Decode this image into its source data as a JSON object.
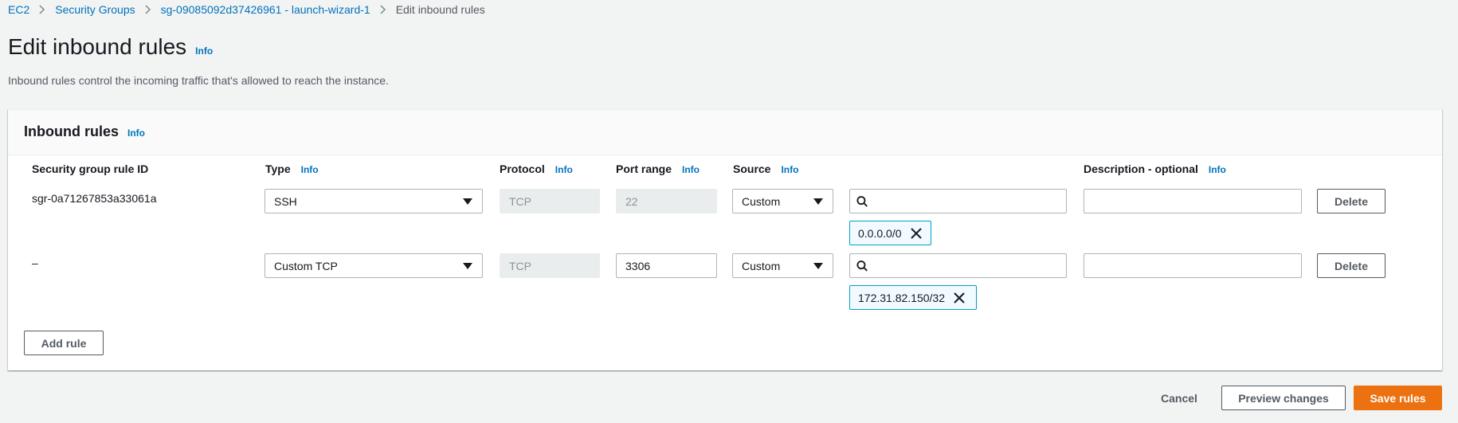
{
  "breadcrumb": {
    "items": [
      "EC2",
      "Security Groups",
      "sg-09085092d37426961 - launch-wizard-1"
    ],
    "current": "Edit inbound rules"
  },
  "page": {
    "title": "Edit inbound rules",
    "info": "Info",
    "description": "Inbound rules control the incoming traffic that's allowed to reach the instance."
  },
  "panel": {
    "title": "Inbound rules",
    "info": "Info",
    "columns": {
      "rule_id": "Security group rule ID",
      "type": "Type",
      "protocol": "Protocol",
      "port_range": "Port range",
      "source": "Source",
      "description": "Description - optional"
    },
    "column_info": "Info",
    "rules": [
      {
        "rule_id": "sgr-0a71267853a33061a",
        "type": "SSH",
        "protocol": "TCP",
        "port_range": "22",
        "source": "Custom",
        "cidr": "0.0.0.0/0",
        "description": "",
        "delete_label": "Delete"
      },
      {
        "rule_id": "–",
        "type": "Custom TCP",
        "protocol": "TCP",
        "port_range": "3306",
        "source": "Custom",
        "cidr": "172.31.82.150/32",
        "description": "",
        "delete_label": "Delete"
      }
    ],
    "add_rule_label": "Add rule"
  },
  "footer": {
    "cancel_label": "Cancel",
    "preview_label": "Preview changes",
    "save_label": "Save rules"
  },
  "colors": {
    "link": "#0073bb",
    "primary": "#ec7211",
    "token_border": "#00a1c9",
    "background": "#f2f3f3"
  }
}
